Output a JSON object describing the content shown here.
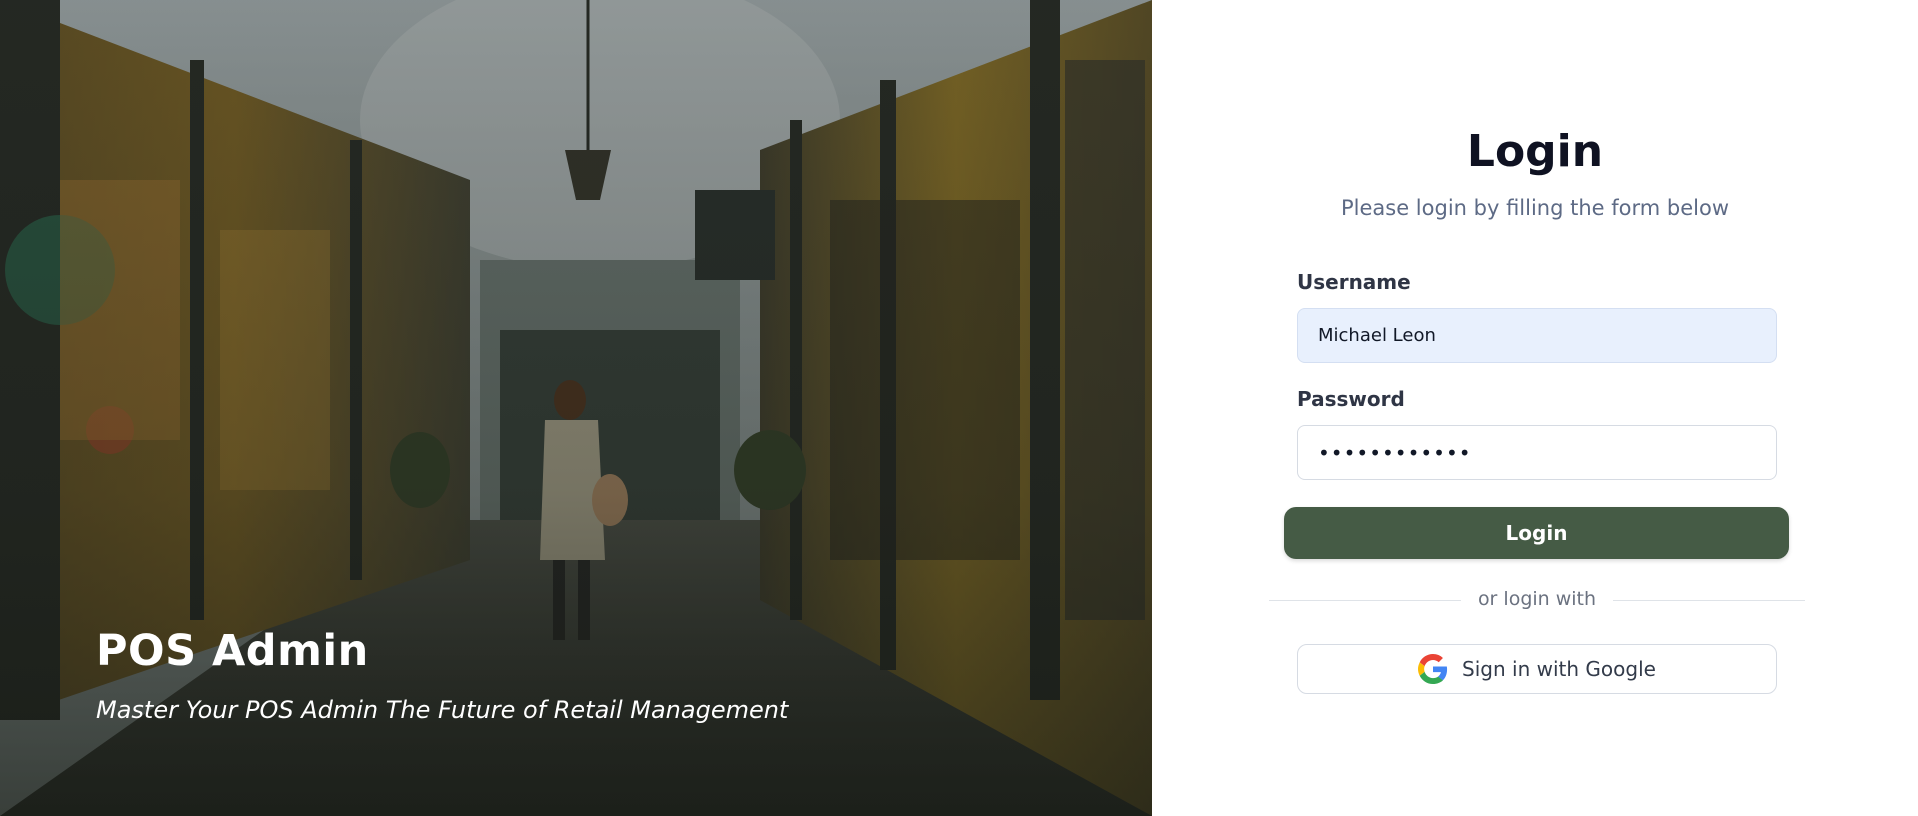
{
  "hero": {
    "title": "POS Admin",
    "subtitle": "Master Your POS Admin The Future of Retail Management"
  },
  "login": {
    "title": "Login",
    "subtitle": "Please login by filling the form below",
    "username_label": "Username",
    "username_value": "Michael Leon",
    "password_label": "Password",
    "password_value": "••••••••••••",
    "submit_label": "Login",
    "divider_text": "or login with",
    "google_label": "Sign in with Google"
  },
  "icons": {
    "google": "google-logo-icon"
  },
  "colors": {
    "primary_button": "#455b45",
    "username_field_bg": "#e8f0fd",
    "title_text": "#0f1222",
    "subtitle_text": "#5d6a85"
  }
}
